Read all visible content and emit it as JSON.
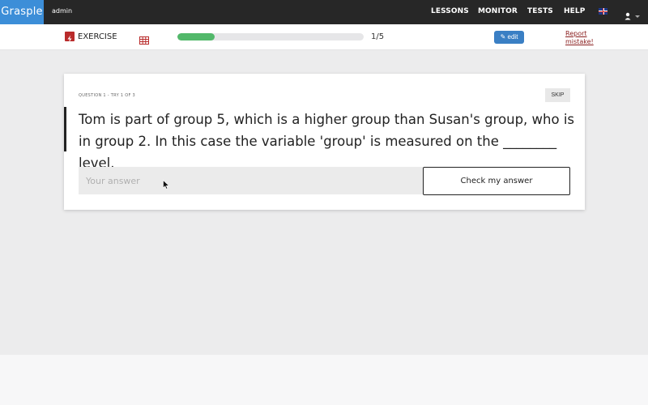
{
  "topbar": {
    "brand": "Grasple",
    "user": "admin",
    "nav": [
      {
        "label": "LESSONS"
      },
      {
        "label": "MONITOR"
      },
      {
        "label": "TESTS"
      },
      {
        "label": "HELP"
      }
    ],
    "language_icon": "uk-flag-icon",
    "user_icon": "user-icon"
  },
  "subbar": {
    "exercise_label": "EXERCISE",
    "progress_percent": 20,
    "progress_text": "1/5",
    "edit_label": "edit",
    "report_label": "Report mistake!"
  },
  "question": {
    "meta": "QUESTION 1 - TRY 1 OF 3",
    "skip_label": "SKIP",
    "text": "Tom is part of group 5, which is a higher group than Susan's group, who is in group 2. In this case the variable 'group' is measured on the ________ level.",
    "answer_placeholder": "Your answer",
    "check_label": "Check my answer"
  },
  "colors": {
    "brand": "#3c8ed8",
    "progress": "#52b86a",
    "edit": "#3a7fc4",
    "report": "#8a1f1f"
  }
}
